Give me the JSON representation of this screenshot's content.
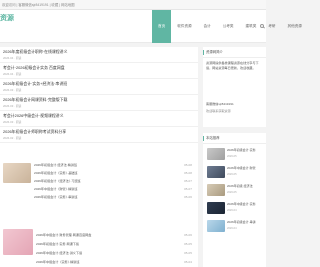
{
  "topbar": {
    "text": "欢迎访问 | 客服微信sjr8419191 | 收藏 | 网站地图"
  },
  "header": {
    "logo": "资源",
    "search_icon": "search-icon"
  },
  "nav": {
    "items": [
      {
        "label": "首页",
        "active": true
      },
      {
        "label": "软件资源",
        "active": false
      },
      {
        "label": "会计",
        "active": false
      },
      {
        "label": "公考类",
        "active": false
      },
      {
        "label": "建筑类",
        "active": false
      },
      {
        "label": "考研",
        "active": false
      },
      {
        "label": "其他资源",
        "active": false
      }
    ]
  },
  "articles": [
    {
      "title": "2026年度初级会计职称·在线课程讲义",
      "meta": "2026-04 · 阅读"
    },
    {
      "title": "考会计·2026初级会计实务 百度网盘",
      "meta": "2026-04 · 阅读"
    },
    {
      "title": "2026年初级会计·实务+经济法·串讲班",
      "meta": "2026-03 · 阅读"
    },
    {
      "title": "2026年初级会计网课资料·完整版下载",
      "meta": "2026-03 · 阅读"
    },
    {
      "title": "考会计2026中级会计·视频课程讲义",
      "meta": "2026-03 · 阅读"
    },
    {
      "title": "2026年初级会计师职称考试资料分享",
      "meta": "2026-02 · 阅读"
    }
  ],
  "latest": [
    {
      "text": "2026年初级会计·经济法·精讲班",
      "date": "05-08"
    },
    {
      "text": "2026年初级会计（实务）·基础班",
      "date": "05-08"
    },
    {
      "text": "2026年初级会计（经济法）·习题班",
      "date": "05-07"
    },
    {
      "text": "2026年中级会计（财管）·精讲班",
      "date": "05-07"
    },
    {
      "text": "2026年初级会计（实务）·串讲班",
      "date": "05-06"
    }
  ],
  "feature_list": [
    {
      "text": "2026年中级会计·财务管理·网课百度网盘",
      "date": "05-06"
    },
    {
      "text": "2026年初级会计·实务·网课下载",
      "date": "05-05"
    },
    {
      "text": "2026年中级会计·经济法·讲义下载",
      "date": "05-05"
    },
    {
      "text": "2026年中级会计（实务）·精讲班",
      "date": "05-04"
    }
  ],
  "sidebar_intro": {
    "title": "资源网简介",
    "body": "资源网提供各类课程资源在线分享与下载，网站资源每日更新，欢迎收藏。",
    "contact": "客服微信sjr8419191",
    "note": "欢迎联系获取资源"
  },
  "sidebar_hot": {
    "title": "本站推荐",
    "items": [
      {
        "text": "2026年初级会计·实务",
        "date": "2026-05"
      },
      {
        "text": "2026年中级会计·财管",
        "date": "2026-05"
      },
      {
        "text": "2026年初级·经济法",
        "date": "2026-05"
      },
      {
        "text": "2026年中级会计·实务",
        "date": "2026-04"
      },
      {
        "text": "2026年初级会计·串讲",
        "date": "2026-04"
      }
    ]
  },
  "colors": {
    "accent": "#60b6a3",
    "bg": "#f3f3f3"
  }
}
